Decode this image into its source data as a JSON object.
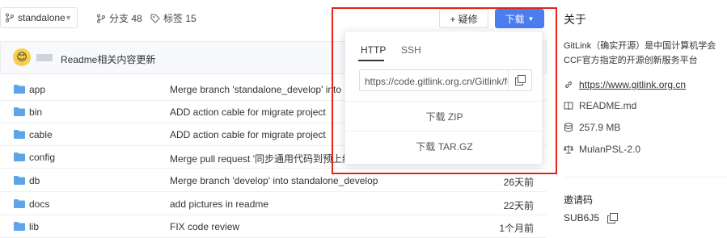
{
  "repo_bar": {
    "branch": "standalone",
    "branches_label": "分支 48",
    "tags_label": "标签 15",
    "fork_label": "+ 疑修",
    "download_label": "下载"
  },
  "readme_bar": {
    "message": "Readme相关内容更新"
  },
  "files": [
    {
      "name": "app",
      "commit": "Merge branch 'standalone_develop' into pre",
      "time": ""
    },
    {
      "name": "bin",
      "commit": "ADD action cable for migrate project",
      "time": ""
    },
    {
      "name": "cable",
      "commit": "ADD action cable for migrate project",
      "time": ""
    },
    {
      "name": "config",
      "commit": "Merge pull request '同步通用代码到预上线' (",
      "time": ""
    },
    {
      "name": "db",
      "commit": "Merge branch 'develop' into standalone_develop",
      "time": "26天前"
    },
    {
      "name": "docs",
      "commit": "add pictures in readme",
      "time": "22天前"
    },
    {
      "name": "lib",
      "commit": "FIX code review",
      "time": "1个月前"
    }
  ],
  "download_popover": {
    "tabs": [
      "HTTP",
      "SSH"
    ],
    "clone_url": "https://code.gitlink.org.cn/Gitlink/forgeplus.git",
    "zip_label": "下载 ZIP",
    "targz_label": "下载 TAR.GZ"
  },
  "sidebar": {
    "about_title": "关于",
    "description": "GitLink（确实开源）是中国计算机学会CCF官方指定的开源创新服务平台",
    "website": "https://www.gitlink.org.cn",
    "readme": "README.md",
    "size": "257.9 MB",
    "license": "MulanPSL-2.0",
    "invite_title": "邀请码",
    "invite_code": "SUB6J5"
  },
  "colors": {
    "primary": "#4b7cf0",
    "folder": "#5ea5e8",
    "highlight_frame": "#e2231a"
  }
}
